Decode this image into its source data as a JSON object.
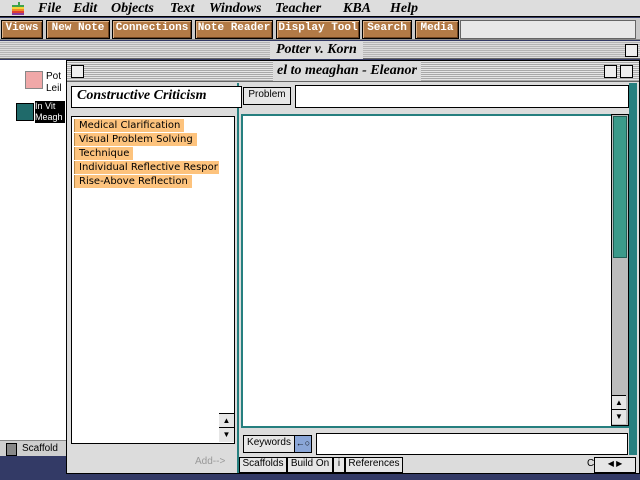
{
  "menubar": {
    "items": [
      "File",
      "Edit",
      "Objects",
      "Text",
      "Windows",
      "Teacher",
      "KBA",
      "Help"
    ]
  },
  "toolbar": {
    "buttons": [
      "Views",
      "New Note",
      "Connections",
      "Note Reader",
      "Display Tool",
      "Search",
      "Media"
    ]
  },
  "outer_window": {
    "title": "Potter v. Korn",
    "notes": [
      {
        "label": "Pot",
        "sub": "Leil"
      },
      {
        "label": "In Vit",
        "sub": "Meagh"
      }
    ],
    "bottom_label": "Scaffold"
  },
  "note_window": {
    "title": "el to meaghan - Eleanor",
    "scaffold": {
      "header": "Constructive Criticism",
      "items": [
        "Medical Clarification",
        "Visual Problem Solving",
        "Technique",
        "Individual Reflective Respor",
        "Rise-Above Reflection"
      ],
      "add_label": "Add-->"
    },
    "problem_button": "Problem",
    "problem_value": "",
    "body_text": "",
    "keywords_button": "Keywords",
    "keywords_icon": "←○",
    "keywords_value": "",
    "tabs": [
      "Scaffolds",
      "Build On",
      "i",
      "References"
    ],
    "corner_label": "C"
  },
  "colors": {
    "toolbar_button": "#b27a46",
    "scaffold_item": "#fdc37d",
    "accent_teal": "#267f7f"
  }
}
